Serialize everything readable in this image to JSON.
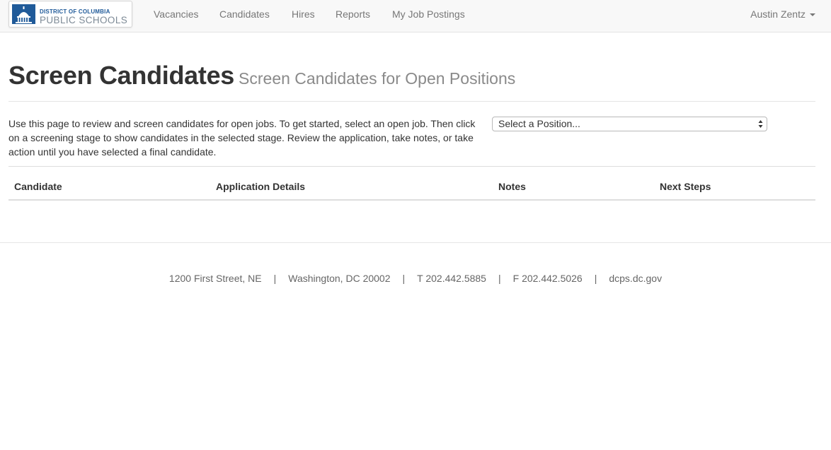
{
  "navbar": {
    "brand": {
      "line1": "DISTRICT OF COLUMBIA",
      "line2": "PUBLIC SCHOOLS",
      "emblem_icon": "capitol-dome-icon",
      "brand_color": "#1f5a99"
    },
    "items": [
      {
        "label": "Vacancies"
      },
      {
        "label": "Candidates"
      },
      {
        "label": "Hires"
      },
      {
        "label": "Reports"
      },
      {
        "label": "My Job Postings"
      }
    ],
    "user": {
      "name": "Austin Zentz",
      "icon": "caret-down-icon"
    }
  },
  "header": {
    "title": "Screen Candidates",
    "subtitle": "Screen Candidates for Open Positions"
  },
  "intro": {
    "text": "Use this page to review and screen candidates for open jobs. To get started, select an open job. Then click on a screening stage to show candidates in the selected stage. Review the application, take notes, or take action until you have selected a final candidate."
  },
  "position_select": {
    "selected": "Select a Position...",
    "icon": "select-arrows-icon"
  },
  "table": {
    "columns": [
      "Candidate",
      "Application Details",
      "Notes",
      "Next Steps"
    ],
    "rows": []
  },
  "footer": {
    "address": "1200 First Street, NE",
    "city": "Washington, DC 20002",
    "phone": "T 202.442.5885",
    "fax": "F 202.442.5026",
    "website": "dcps.dc.gov",
    "separator": "|"
  }
}
